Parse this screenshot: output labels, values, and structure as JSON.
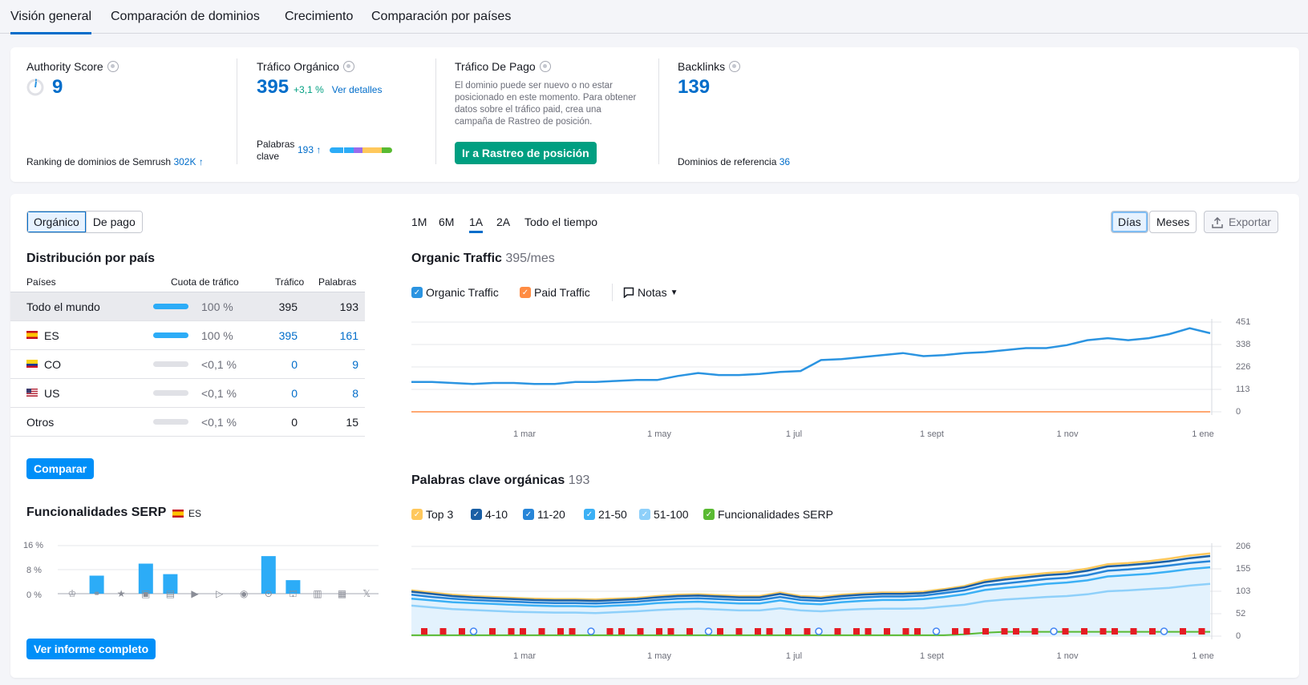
{
  "tabs": [
    "Visión general",
    "Comparación de dominios",
    "Crecimiento",
    "Comparación por países"
  ],
  "summary": {
    "authority": {
      "title": "Authority Score",
      "value": "9",
      "ranking_label": "Ranking de dominios de Semrush",
      "ranking_value": "302K"
    },
    "organic": {
      "title": "Tráfico Orgánico",
      "value": "395",
      "change": "+3,1 %",
      "details": "Ver detalles",
      "kw_label_1": "Palabras",
      "kw_label_2": "clave",
      "kw_value": "193"
    },
    "paid": {
      "title": "Tráfico De Pago",
      "text": "El dominio puede ser nuevo o no estar posicionado en este momento. Para obtener datos sobre el tráfico paid, crea una campaña de Rastreo de posición.",
      "button": "Ir a Rastreo de posición"
    },
    "backlinks": {
      "title": "Backlinks",
      "value": "139",
      "ref_label": "Dominios de referencia",
      "ref_value": "36"
    }
  },
  "toggle": {
    "organic": "Orgánico",
    "paid": "De pago"
  },
  "country": {
    "title": "Distribución por país",
    "headers": [
      "Países",
      "Cuota de tráfico",
      "Tráfico",
      "Palabras ..."
    ],
    "rows": [
      {
        "name": "Todo el mundo",
        "share": "100 %",
        "traffic": "395",
        "keywords": "193"
      },
      {
        "name": "ES",
        "share": "100 %",
        "traffic": "395",
        "keywords": "161"
      },
      {
        "name": "CO",
        "share": "<0,1 %",
        "traffic": "0",
        "keywords": "9"
      },
      {
        "name": "US",
        "share": "<0,1 %",
        "traffic": "0",
        "keywords": "8"
      },
      {
        "name": "Otros",
        "share": "<0,1 %",
        "traffic": "0",
        "keywords": "15"
      }
    ],
    "compare_button": "Comparar"
  },
  "serp": {
    "title": "Funcionalidades SERP",
    "flag_label": "ES",
    "y_labels": [
      "16 %",
      "8 %",
      "0 %"
    ],
    "report_button": "Ver informe completo",
    "icons": [
      "crown-icon",
      "link-icon",
      "star-icon",
      "image-icon",
      "gallery-icon",
      "play-icon",
      "video-icon",
      "play-circle-icon",
      "pin-icon",
      "cap-icon",
      "news-icon",
      "briefcase-icon",
      "x-icon"
    ],
    "values": [
      0,
      6,
      0,
      10,
      6.5,
      0,
      0,
      0,
      12.5,
      4.5,
      0,
      0,
      0
    ]
  },
  "timeframes": [
    "1M",
    "6M",
    "1A",
    "2A",
    "Todo el tiempo"
  ],
  "view": {
    "days": "Días",
    "months": "Meses",
    "export": "Exportar"
  },
  "traffic_chart": {
    "title": "Organic Traffic",
    "subtitle": "395/mes",
    "legend": [
      "Organic Traffic",
      "Paid Traffic"
    ],
    "notes": "Notas",
    "y_labels": [
      "451",
      "338",
      "226",
      "113",
      "0"
    ],
    "x_labels": [
      "1 mar",
      "1 may",
      "1 jul",
      "1 sept",
      "1 nov",
      "1 ene"
    ]
  },
  "keywords_chart": {
    "title": "Palabras clave orgánicas",
    "subtitle": "193",
    "legend": [
      "Top 3",
      "4-10",
      "11-20",
      "21-50",
      "51-100",
      "Funcionalidades SERP"
    ],
    "y_labels": [
      "206",
      "155",
      "103",
      "52",
      "0"
    ],
    "x_labels": [
      "1 mar",
      "1 may",
      "1 jul",
      "1 sept",
      "1 nov",
      "1 ene"
    ]
  },
  "chart_data": [
    {
      "type": "line",
      "title": "Organic Traffic",
      "ylim": [
        0,
        451
      ],
      "x_ticks": [
        "1 mar",
        "1 may",
        "1 jul",
        "1 sept",
        "1 nov",
        "1 ene"
      ],
      "series": [
        {
          "name": "Organic Traffic",
          "values": [
            150,
            150,
            145,
            140,
            145,
            145,
            140,
            140,
            150,
            150,
            155,
            160,
            160,
            180,
            195,
            185,
            185,
            190,
            200,
            205,
            260,
            265,
            275,
            285,
            295,
            280,
            285,
            295,
            300,
            310,
            320,
            320,
            335,
            360,
            370,
            360,
            370,
            390,
            420,
            395
          ]
        },
        {
          "name": "Paid Traffic",
          "values": [
            0,
            0,
            0,
            0,
            0,
            0,
            0,
            0,
            0,
            0,
            0,
            0,
            0,
            0,
            0,
            0,
            0,
            0,
            0,
            0,
            0,
            0,
            0,
            0,
            0,
            0,
            0,
            0,
            0,
            0,
            0,
            0,
            0,
            0,
            0,
            0,
            0,
            0,
            0,
            0
          ]
        }
      ]
    },
    {
      "type": "area",
      "title": "Palabras clave orgánicas",
      "ylim": [
        0,
        206
      ],
      "x_ticks": [
        "1 mar",
        "1 may",
        "1 jul",
        "1 sept",
        "1 nov",
        "1 ene"
      ],
      "series": [
        {
          "name": "Top 3",
          "values": [
            105,
            100,
            95,
            92,
            90,
            88,
            86,
            85,
            85,
            84,
            86,
            88,
            92,
            95,
            96,
            94,
            92,
            92,
            100,
            92,
            90,
            95,
            98,
            100,
            100,
            102,
            108,
            115,
            128,
            135,
            140,
            145,
            148,
            155,
            165,
            168,
            172,
            178,
            185,
            190
          ]
        },
        {
          "name": "4-10",
          "values": [
            102,
            97,
            92,
            89,
            87,
            85,
            83,
            82,
            82,
            81,
            83,
            85,
            89,
            92,
            93,
            91,
            89,
            89,
            97,
            89,
            87,
            92,
            95,
            97,
            97,
            99,
            105,
            112,
            124,
            130,
            135,
            140,
            143,
            150,
            160,
            163,
            167,
            172,
            179,
            184
          ]
        },
        {
          "name": "11-20",
          "values": [
            95,
            90,
            86,
            83,
            81,
            79,
            77,
            76,
            76,
            75,
            77,
            79,
            83,
            86,
            87,
            85,
            83,
            83,
            90,
            83,
            81,
            86,
            89,
            91,
            91,
            93,
            99,
            105,
            116,
            121,
            126,
            131,
            134,
            140,
            150,
            153,
            157,
            162,
            168,
            172
          ]
        },
        {
          "name": "21-50",
          "values": [
            86,
            82,
            78,
            76,
            74,
            72,
            70,
            69,
            69,
            68,
            70,
            72,
            76,
            78,
            79,
            77,
            75,
            75,
            82,
            75,
            73,
            78,
            81,
            83,
            83,
            85,
            90,
            96,
            106,
            111,
            115,
            120,
            123,
            128,
            137,
            140,
            143,
            148,
            154,
            158
          ]
        },
        {
          "name": "51-100",
          "values": [
            70,
            66,
            62,
            60,
            58,
            56,
            55,
            54,
            54,
            53,
            55,
            57,
            60,
            62,
            63,
            61,
            59,
            59,
            64,
            59,
            57,
            60,
            62,
            63,
            63,
            64,
            68,
            72,
            80,
            84,
            87,
            90,
            92,
            96,
            103,
            105,
            108,
            111,
            116,
            120
          ]
        },
        {
          "name": "Funcionalidades SERP",
          "values": [
            2,
            2,
            2,
            2,
            2,
            2,
            2,
            2,
            2,
            2,
            2,
            2,
            2,
            2,
            2,
            2,
            2,
            2,
            2,
            2,
            2,
            2,
            2,
            2,
            2,
            2,
            2,
            4,
            8,
            10,
            10,
            10,
            10,
            10,
            10,
            10,
            10,
            10,
            10,
            10
          ]
        }
      ]
    },
    {
      "type": "bar",
      "title": "Funcionalidades SERP",
      "categories": [
        "crown-icon",
        "link-icon",
        "star-icon",
        "image-icon",
        "gallery-icon",
        "play-icon",
        "video-icon",
        "play-circle-icon",
        "pin-icon",
        "cap-icon",
        "news-icon",
        "briefcase-icon",
        "x-icon"
      ],
      "values": [
        0,
        6,
        0,
        10,
        6.5,
        0,
        0,
        0,
        12.5,
        4.5,
        0,
        0,
        0
      ],
      "ylim": [
        0,
        16
      ]
    }
  ],
  "colors": {
    "accent": "#006dca",
    "organic": "#2b94e1",
    "paid": "#ff8c43",
    "top3": "#ffc85c",
    "k410": "#1a5fa5",
    "k1120": "#2785d8",
    "k2150": "#3bb0f5",
    "k51100": "#8ed0fa",
    "serp": "#59ba32",
    "green_btn": "#009f81"
  }
}
